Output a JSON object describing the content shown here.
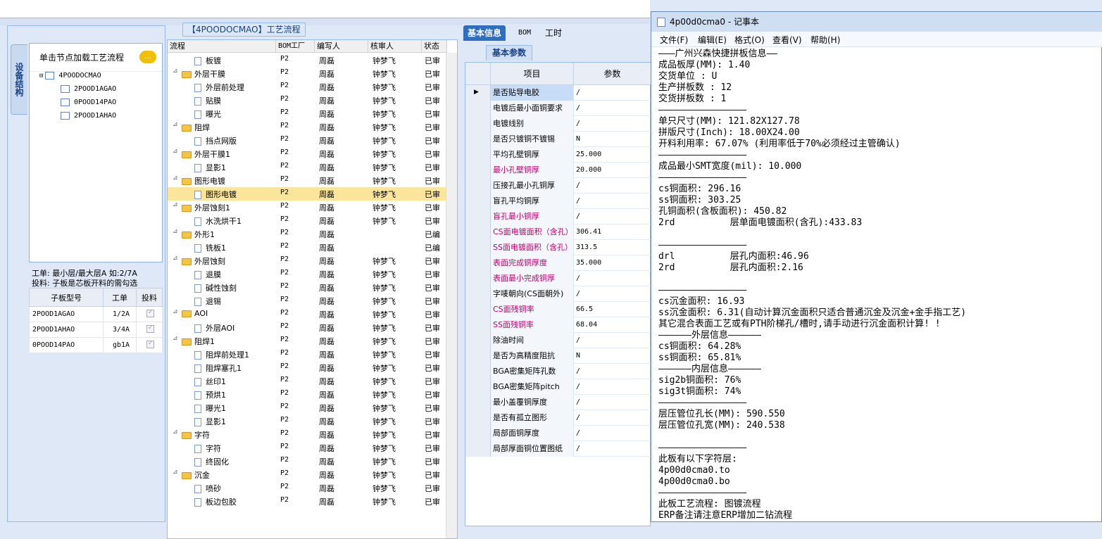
{
  "device_panel": {
    "vtab_label": "设备结构",
    "tree_header": "单击节点加载工艺流程",
    "tree_root": "4POODOCMAO",
    "tree_children": [
      "2POOD1AGAO",
      "0POOD14PAO",
      "2POOD1AHAO"
    ],
    "hint_line1": "工单: 最小层/最大层A 如:2/7A",
    "hint_line2": "投料: 子板是芯板开料的需勾选",
    "sub_headers": [
      "子板型号",
      "工单",
      "投料"
    ],
    "sub_rows": [
      {
        "model": "2POOD1AGAO",
        "order": "1/2A"
      },
      {
        "model": "2POOD1AHAO",
        "order": "3/4A"
      },
      {
        "model": "0POOD14PAO",
        "order": "gb1A"
      }
    ]
  },
  "process_panel": {
    "title": "【4POODOCMAO】工艺流程",
    "headers": [
      "流程",
      "BOM工厂",
      "编写人",
      "核审人",
      "状态"
    ],
    "rows": [
      {
        "name": "板镀",
        "lvl": 2,
        "bom": "P2",
        "writer": "周磊",
        "checker": "钟梦飞",
        "status": "已审"
      },
      {
        "name": "外层干膜",
        "lvl": 1,
        "bom": "P2",
        "writer": "周磊",
        "checker": "钟梦飞",
        "status": "已审"
      },
      {
        "name": "外层前处理",
        "lvl": 2,
        "bom": "P2",
        "writer": "周磊",
        "checker": "钟梦飞",
        "status": "已审"
      },
      {
        "name": "贴膜",
        "lvl": 2,
        "bom": "P2",
        "writer": "周磊",
        "checker": "钟梦飞",
        "status": "已审"
      },
      {
        "name": "曝光",
        "lvl": 2,
        "bom": "P2",
        "writer": "周磊",
        "checker": "钟梦飞",
        "status": "已审"
      },
      {
        "name": "阻焊",
        "lvl": 1,
        "bom": "P2",
        "writer": "周磊",
        "checker": "钟梦飞",
        "status": "已审"
      },
      {
        "name": "挡点网版",
        "lvl": 2,
        "bom": "P2",
        "writer": "周磊",
        "checker": "钟梦飞",
        "status": "已审"
      },
      {
        "name": "外层干膜1",
        "lvl": 1,
        "bom": "P2",
        "writer": "周磊",
        "checker": "钟梦飞",
        "status": "已审"
      },
      {
        "name": "显影1",
        "lvl": 2,
        "bom": "P2",
        "writer": "周磊",
        "checker": "钟梦飞",
        "status": "已审"
      },
      {
        "name": "图形电镀",
        "lvl": 1,
        "bom": "P2",
        "writer": "周磊",
        "checker": "钟梦飞",
        "status": "已审"
      },
      {
        "name": "图形电镀",
        "lvl": 2,
        "bom": "P2",
        "writer": "周磊",
        "checker": "钟梦飞",
        "status": "已审",
        "sel": true
      },
      {
        "name": "外层蚀刻1",
        "lvl": 1,
        "bom": "P2",
        "writer": "周磊",
        "checker": "钟梦飞",
        "status": "已审"
      },
      {
        "name": "水洗烘干1",
        "lvl": 2,
        "bom": "P2",
        "writer": "周磊",
        "checker": "钟梦飞",
        "status": "已审"
      },
      {
        "name": "外形1",
        "lvl": 1,
        "bom": "P2",
        "writer": "周磊",
        "checker": "",
        "status": "已编"
      },
      {
        "name": "铣板1",
        "lvl": 2,
        "bom": "P2",
        "writer": "周磊",
        "checker": "",
        "status": "已编"
      },
      {
        "name": "外层蚀刻",
        "lvl": 1,
        "bom": "P2",
        "writer": "周磊",
        "checker": "钟梦飞",
        "status": "已审"
      },
      {
        "name": "退膜",
        "lvl": 2,
        "bom": "P2",
        "writer": "周磊",
        "checker": "钟梦飞",
        "status": "已审"
      },
      {
        "name": "碱性蚀刻",
        "lvl": 2,
        "bom": "P2",
        "writer": "周磊",
        "checker": "钟梦飞",
        "status": "已审"
      },
      {
        "name": "退锡",
        "lvl": 2,
        "bom": "P2",
        "writer": "周磊",
        "checker": "钟梦飞",
        "status": "已审"
      },
      {
        "name": "AOI",
        "lvl": 1,
        "bom": "P2",
        "writer": "周磊",
        "checker": "钟梦飞",
        "status": "已审"
      },
      {
        "name": "外层AOI",
        "lvl": 2,
        "bom": "P2",
        "writer": "周磊",
        "checker": "钟梦飞",
        "status": "已审"
      },
      {
        "name": "阻焊1",
        "lvl": 1,
        "bom": "P2",
        "writer": "周磊",
        "checker": "钟梦飞",
        "status": "已审"
      },
      {
        "name": "阻焊前处理1",
        "lvl": 2,
        "bom": "P2",
        "writer": "周磊",
        "checker": "钟梦飞",
        "status": "已审"
      },
      {
        "name": "阻焊塞孔1",
        "lvl": 2,
        "bom": "P2",
        "writer": "周磊",
        "checker": "钟梦飞",
        "status": "已审"
      },
      {
        "name": "丝印1",
        "lvl": 2,
        "bom": "P2",
        "writer": "周磊",
        "checker": "钟梦飞",
        "status": "已审"
      },
      {
        "name": "预烘1",
        "lvl": 2,
        "bom": "P2",
        "writer": "周磊",
        "checker": "钟梦飞",
        "status": "已审"
      },
      {
        "name": "曝光1",
        "lvl": 2,
        "bom": "P2",
        "writer": "周磊",
        "checker": "钟梦飞",
        "status": "已审"
      },
      {
        "name": "显影1",
        "lvl": 2,
        "bom": "P2",
        "writer": "周磊",
        "checker": "钟梦飞",
        "status": "已审"
      },
      {
        "name": "字符",
        "lvl": 1,
        "bom": "P2",
        "writer": "周磊",
        "checker": "钟梦飞",
        "status": "已审"
      },
      {
        "name": "字符",
        "lvl": 2,
        "bom": "P2",
        "writer": "周磊",
        "checker": "钟梦飞",
        "status": "已审"
      },
      {
        "name": "终固化",
        "lvl": 2,
        "bom": "P2",
        "writer": "周磊",
        "checker": "钟梦飞",
        "status": "已审"
      },
      {
        "name": "沉金",
        "lvl": 1,
        "bom": "P2",
        "writer": "周磊",
        "checker": "钟梦飞",
        "status": "已审"
      },
      {
        "name": "喷砂",
        "lvl": 2,
        "bom": "P2",
        "writer": "周磊",
        "checker": "钟梦飞",
        "status": "已审"
      },
      {
        "name": "板边包胶",
        "lvl": 2,
        "bom": "P2",
        "writer": "周磊",
        "checker": "钟梦飞",
        "status": "已审"
      }
    ]
  },
  "info_panel": {
    "tabs": [
      "基本信息",
      "BOM",
      "工时"
    ],
    "sub_tab": "基本参数",
    "headers": [
      "项目",
      "参数"
    ],
    "rows": [
      {
        "k": "是否贴导电胶",
        "v": "/",
        "cur": true
      },
      {
        "k": "电镀后最小面铜要求",
        "v": "/"
      },
      {
        "k": "电镀线别",
        "v": "/"
      },
      {
        "k": "是否只镀铜不镀锡",
        "v": "N"
      },
      {
        "k": "平均孔壁铜厚",
        "v": "25.000"
      },
      {
        "k": "最小孔壁铜厚",
        "v": "20.000",
        "red": true
      },
      {
        "k": "压接孔最小孔铜厚",
        "v": "/"
      },
      {
        "k": "盲孔平均铜厚",
        "v": "/"
      },
      {
        "k": "盲孔最小铜厚",
        "v": "/",
        "red": true
      },
      {
        "k": "CS面电镀面积（含孔）",
        "v": "306.41",
        "red": true
      },
      {
        "k": "SS面电镀面积（含孔）",
        "v": "313.5",
        "red": true
      },
      {
        "k": "表面完成铜厚度",
        "v": "35.000",
        "red": true
      },
      {
        "k": "表面最小完成铜厚",
        "v": "/",
        "red": true
      },
      {
        "k": "字唛朝向(CS面朝外)",
        "v": "/"
      },
      {
        "k": "CS面残铜率",
        "v": "66.5",
        "red": true
      },
      {
        "k": "SS面残铜率",
        "v": "68.04",
        "red": true
      },
      {
        "k": "除油时间",
        "v": "/"
      },
      {
        "k": "是否为高精度阻抗",
        "v": "N"
      },
      {
        "k": "BGA密集矩阵孔数",
        "v": "/"
      },
      {
        "k": "BGA密集矩阵pitch",
        "v": "/"
      },
      {
        "k": "最小盖覆铜厚度",
        "v": "/"
      },
      {
        "k": "是否有孤立图形",
        "v": "/"
      },
      {
        "k": "局部面铜厚度",
        "v": "/"
      },
      {
        "k": "局部厚面铜位置图纸",
        "v": "/"
      }
    ]
  },
  "notepad": {
    "title": "4p00d0cma0 - 记事本",
    "menu": [
      "文件(F)",
      "编辑(E)",
      "格式(O)",
      "查看(V)",
      "帮助(H)"
    ],
    "text": "———广州兴森快捷拼板信息——\n成品板厚(MM): 1.40\n交货单位 : U\n生产拼板数 : 12\n交货拼板数 : 1\n————————————————\n单只尺寸(MM): 121.82X127.78\n拼版尺寸(Inch): 18.00X24.00\n开料利用率: 67.07% (利用率低于70%必须经过主管确认)\n————————————————\n成品最小SMT宽度(mil): 10.000\n————————————————\ncs铜面积: 296.16\nss铜面积: 303.25\n孔铜面积(含板面积): 450.82\n2rd          层单面电镀面积(含孔):433.83\n\n————————————————\ndrl          层孔内面积:46.96\n2rd          层孔内面积:2.16\n\n————————————————\ncs沉金面积: 16.93\nss沉金面积: 6.31(自动计算沉金面积只适合普通沉金及沉金+金手指工艺)\n其它混合表面工艺或有PTH阶梯孔/槽时,请手动进行沉金面积计算! !\n——————外层信息——————\ncs铜面积: 64.28%\nss铜面积: 65.81%\n——————内层信息——————\nsig2b铜面积: 76%\nsig3t铜面积: 74%\n————————————————\n层压管位孔长(MM): 590.550\n层压管位孔宽(MM): 240.538\n\n————————————————\n此板有以下字符层:\n4p00d0cma0.to\n4p00d0cma0.bo\n————————————————\n此板工艺流程: 图镀流程\nERP备注请注意ERP增加二钻流程"
  }
}
